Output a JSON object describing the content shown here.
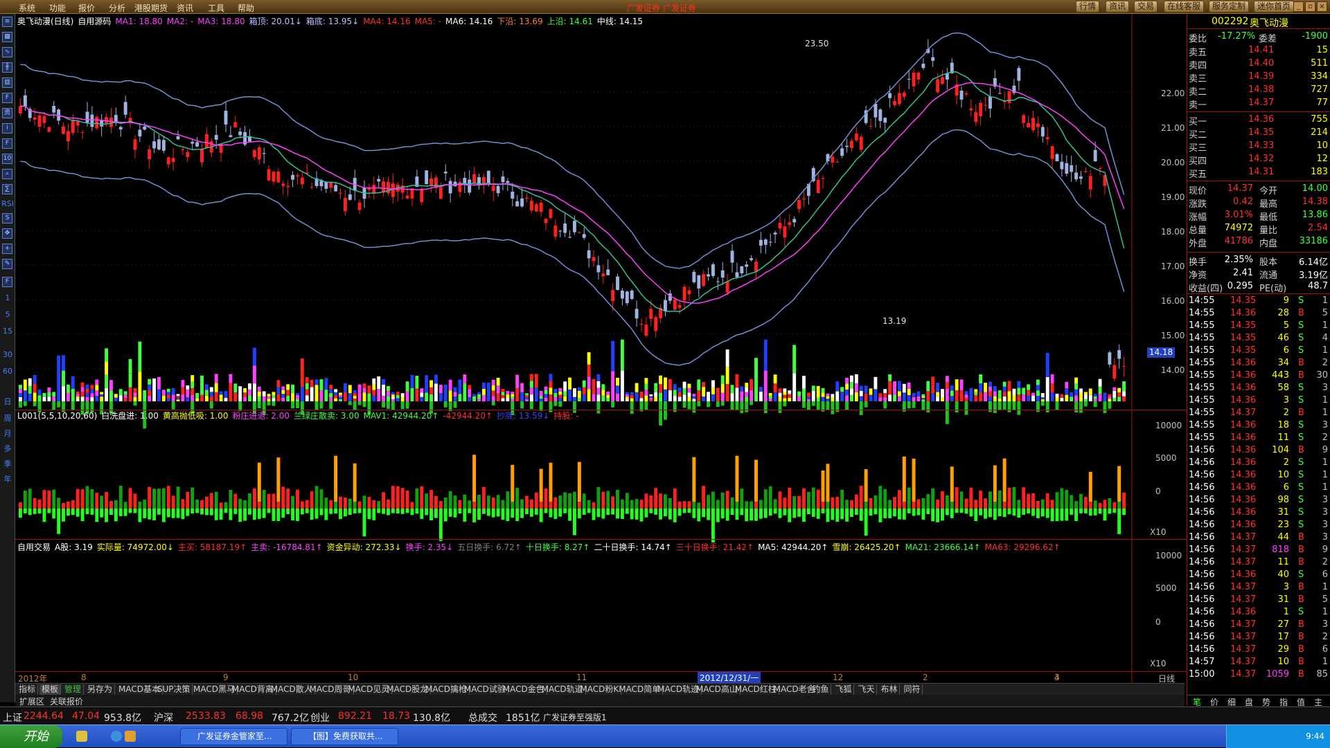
{
  "menu": {
    "items": [
      "系统",
      "功能",
      "报价",
      "分析",
      "港股期货",
      "资讯",
      "工具",
      "帮助"
    ],
    "brand": "广发证券 广发证券",
    "right_buttons": [
      "行情",
      "资讯",
      "交易",
      "在线客服",
      "服务定制",
      "迷你首页"
    ]
  },
  "left_toolbar": {
    "periods": [
      "1",
      "5",
      "15",
      "30",
      "60",
      "日",
      "周",
      "月",
      "多",
      "季",
      "年"
    ]
  },
  "main_panel": {
    "title": "奥飞动漫(日线)",
    "source": "自用源码",
    "indicators": [
      {
        "text": "MA1: 18.80",
        "color": "#ff40ff"
      },
      {
        "text": "MA2: -",
        "color": "#ff40ff"
      },
      {
        "text": "MA3: 18.80",
        "color": "#ff40ff"
      },
      {
        "text": "箱顶: 20.01↓",
        "color": "#c0c0ff"
      },
      {
        "text": "箱底: 13.95↓",
        "color": "#c0c0ff"
      },
      {
        "text": "MA4: 14.16",
        "color": "#ff3030"
      },
      {
        "text": "MA5: -",
        "color": "#ff3030"
      },
      {
        "text": "MA6: 14.16",
        "color": "#ffffff"
      },
      {
        "text": "下沿: 13.69",
        "color": "#ff8040"
      },
      {
        "text": "上沿: 14.61",
        "color": "#40ff40"
      },
      {
        "text": "中线: 14.15",
        "color": "#ffffff"
      }
    ],
    "y_labels": [
      "22.00",
      "21.00",
      "20.00",
      "19.00",
      "18.00",
      "17.00",
      "16.00",
      "15.00",
      "14.00"
    ],
    "high_label": "23.50",
    "low_label": "13.19",
    "current_tag": "14.18"
  },
  "mid_panel": {
    "title": "L001(5,5,10,20,60)",
    "indicators": [
      {
        "text": "白洗盘进: 1.00",
        "color": "#ffffff"
      },
      {
        "text": "黄高抛低吸: 1.00",
        "color": "#ffff00"
      },
      {
        "text": "粉庄进退: 2.00",
        "color": "#ff40ff"
      },
      {
        "text": "兰绿庄散卖: 3.00",
        "color": "#40ff40"
      },
      {
        "text": "MAV1: 42944.20↑",
        "color": "#40ff40"
      },
      {
        "text": "-42944.20↑",
        "color": "#ff3030"
      },
      {
        "text": "抄底: 13.59↓",
        "color": "#4040ff"
      },
      {
        "text": "持股: -",
        "color": "#ff3030"
      }
    ],
    "y_labels": [
      "10000",
      "5000",
      "0"
    ],
    "scale": "X10"
  },
  "low_panel": {
    "title": "自用交易",
    "indicators": [
      {
        "text": "A股: 3.19",
        "color": "#ffffff"
      },
      {
        "text": "实际量: 74972.00↓",
        "color": "#ffff00"
      },
      {
        "text": "主买: 58187.19↑",
        "color": "#ff3030"
      },
      {
        "text": "主卖: -16784.81↑",
        "color": "#ff40ff"
      },
      {
        "text": "资金异动: 272.33↓",
        "color": "#ffff00"
      },
      {
        "text": "换手: 2.35↓",
        "color": "#ff40ff"
      },
      {
        "text": "五日换手: 6.72↑",
        "color": "#808080"
      },
      {
        "text": "十日换手: 8.27↑",
        "color": "#40ff40"
      },
      {
        "text": "二十日换手: 14.74↑",
        "color": "#ffffff"
      },
      {
        "text": "三十日换手: 21.42↑",
        "color": "#ff3030"
      },
      {
        "text": "MA5: 42944.20↑",
        "color": "#ffffff"
      },
      {
        "text": "雪崩: 26425.20↑",
        "color": "#ffff00"
      },
      {
        "text": "MA21: 23666.14↑",
        "color": "#40ff40"
      },
      {
        "text": "MA63: 29296.62↑",
        "color": "#ff3030"
      }
    ],
    "y_labels": [
      "10000",
      "5000",
      "0"
    ],
    "scale": "X10"
  },
  "time_axis": {
    "labels": [
      "2012年",
      "8",
      "9",
      "10",
      "11",
      "12",
      "2",
      "3",
      "4"
    ],
    "highlight": "2012/12/31/一",
    "right_label": "日线"
  },
  "bottom_tabs": [
    "指标",
    "模板",
    "管理",
    "另存为",
    "MACD基本",
    "SUP决策",
    "MACD黑马",
    "MACD背离",
    "MACD散人",
    "MACD周哥",
    "MACD见灵",
    "MACD股龙",
    "MACD擒枪",
    "MACD试验",
    "MACD金色",
    "MACD轨道",
    "MACD粉K",
    "MACD简单",
    "MACD轨迹",
    "MACD高山",
    "MACD红柱",
    "MACD老舍",
    "钓鱼",
    "飞狐",
    "飞天",
    "布林",
    "同符"
  ],
  "ext_tabs": [
    "扩展区",
    "关联报价"
  ],
  "quote": {
    "code": "002292",
    "name": "奥飞动漫",
    "webi": {
      "label": "委比",
      "value": "-17.27%",
      "label2": "委差",
      "value2": "-1900"
    },
    "asks": [
      {
        "label": "卖五",
        "price": "14.41",
        "vol": "15"
      },
      {
        "label": "卖四",
        "price": "14.40",
        "vol": "511"
      },
      {
        "label": "卖三",
        "price": "14.39",
        "vol": "334"
      },
      {
        "label": "卖二",
        "price": "14.38",
        "vol": "727"
      },
      {
        "label": "卖一",
        "price": "14.37",
        "vol": "77"
      }
    ],
    "bids": [
      {
        "label": "买一",
        "price": "14.36",
        "vol": "755"
      },
      {
        "label": "买二",
        "price": "14.35",
        "vol": "214"
      },
      {
        "label": "买三",
        "price": "14.33",
        "vol": "10"
      },
      {
        "label": "买四",
        "price": "14.32",
        "vol": "12"
      },
      {
        "label": "买五",
        "price": "14.31",
        "vol": "183"
      }
    ],
    "stats": [
      {
        "l1": "现价",
        "v1": "14.37",
        "c1": "#ff3030",
        "l2": "今开",
        "v2": "14.00",
        "c2": "#40ff40"
      },
      {
        "l1": "涨跌",
        "v1": "0.42",
        "c1": "#ff3030",
        "l2": "最高",
        "v2": "14.38",
        "c2": "#ff3030"
      },
      {
        "l1": "涨幅",
        "v1": "3.01%",
        "c1": "#ff3030",
        "l2": "最低",
        "v2": "13.86",
        "c2": "#40ff40"
      },
      {
        "l1": "总量",
        "v1": "74972",
        "c1": "#ffff00",
        "l2": "量比",
        "v2": "2.54",
        "c2": "#ff3030"
      },
      {
        "l1": "外盘",
        "v1": "41786",
        "c1": "#ff3030",
        "l2": "内盘",
        "v2": "33186",
        "c2": "#40ff40"
      },
      {
        "l1": "换手",
        "v1": "2.35%",
        "c1": "#ffffff",
        "l2": "股本",
        "v2": "6.14亿",
        "c2": "#ffffff"
      },
      {
        "l1": "净资",
        "v1": "2.41",
        "c1": "#ffffff",
        "l2": "流通",
        "v2": "3.19亿",
        "c2": "#ffffff"
      },
      {
        "l1": "收益(四)",
        "v1": "0.295",
        "c1": "#ffffff",
        "l2": "PE(动)",
        "v2": "48.7",
        "c2": "#ffffff"
      }
    ],
    "ticks": [
      {
        "t": "14:55",
        "p": "14.35",
        "v": "9",
        "d": "S",
        "n": "1"
      },
      {
        "t": "14:55",
        "p": "14.36",
        "v": "28",
        "d": "B",
        "n": "5"
      },
      {
        "t": "14:55",
        "p": "14.35",
        "v": "5",
        "d": "S",
        "n": "1"
      },
      {
        "t": "14:55",
        "p": "14.35",
        "v": "46",
        "d": "S",
        "n": "4"
      },
      {
        "t": "14:55",
        "p": "14.35",
        "v": "6",
        "d": "S",
        "n": "1"
      },
      {
        "t": "14:55",
        "p": "14.36",
        "v": "34",
        "d": "B",
        "n": "2"
      },
      {
        "t": "14:55",
        "p": "14.36",
        "v": "443",
        "d": "B",
        "n": "30"
      },
      {
        "t": "14:55",
        "p": "14.36",
        "v": "58",
        "d": "S",
        "n": "3"
      },
      {
        "t": "14:55",
        "p": "14.36",
        "v": "3",
        "d": "S",
        "n": "1"
      },
      {
        "t": "14:55",
        "p": "14.37",
        "v": "2",
        "d": "B",
        "n": "1"
      },
      {
        "t": "14:55",
        "p": "14.36",
        "v": "18",
        "d": "S",
        "n": "3"
      },
      {
        "t": "14:55",
        "p": "14.36",
        "v": "11",
        "d": "S",
        "n": "2"
      },
      {
        "t": "14:56",
        "p": "14.36",
        "v": "104",
        "d": "B",
        "n": "9"
      },
      {
        "t": "14:56",
        "p": "14.36",
        "v": "2",
        "d": "S",
        "n": "1"
      },
      {
        "t": "14:56",
        "p": "14.36",
        "v": "10",
        "d": "S",
        "n": "1"
      },
      {
        "t": "14:56",
        "p": "14.36",
        "v": "6",
        "d": "S",
        "n": "1"
      },
      {
        "t": "14:56",
        "p": "14.36",
        "v": "98",
        "d": "S",
        "n": "3"
      },
      {
        "t": "14:56",
        "p": "14.36",
        "v": "31",
        "d": "S",
        "n": "3"
      },
      {
        "t": "14:56",
        "p": "14.36",
        "v": "23",
        "d": "S",
        "n": "3"
      },
      {
        "t": "14:56",
        "p": "14.37",
        "v": "44",
        "d": "B",
        "n": "3"
      },
      {
        "t": "14:56",
        "p": "14.37",
        "v": "818",
        "d": "B",
        "n": "9"
      },
      {
        "t": "14:56",
        "p": "14.37",
        "v": "11",
        "d": "B",
        "n": "2"
      },
      {
        "t": "14:56",
        "p": "14.36",
        "v": "40",
        "d": "S",
        "n": "6"
      },
      {
        "t": "14:56",
        "p": "14.37",
        "v": "3",
        "d": "B",
        "n": "1"
      },
      {
        "t": "14:56",
        "p": "14.37",
        "v": "31",
        "d": "B",
        "n": "5"
      },
      {
        "t": "14:56",
        "p": "14.36",
        "v": "1",
        "d": "S",
        "n": "1"
      },
      {
        "t": "14:56",
        "p": "14.37",
        "v": "27",
        "d": "B",
        "n": "3"
      },
      {
        "t": "14:56",
        "p": "14.37",
        "v": "17",
        "d": "B",
        "n": "2"
      },
      {
        "t": "14:56",
        "p": "14.37",
        "v": "29",
        "d": "B",
        "n": "6"
      },
      {
        "t": "14:57",
        "p": "14.37",
        "v": "10",
        "d": "B",
        "n": "1"
      },
      {
        "t": "15:00",
        "p": "14.37",
        "v": "1059",
        "d": "B",
        "n": "85"
      }
    ],
    "panel_tabs": [
      "笔",
      "价",
      "细",
      "盘",
      "势",
      "指",
      "值",
      "主"
    ]
  },
  "statusbar": {
    "items": [
      {
        "text": "上证",
        "color": "#e0e0e0"
      },
      {
        "text": "2244.64",
        "color": "#ff3030"
      },
      {
        "text": "47.04",
        "color": "#ff3030"
      },
      {
        "text": "953.8亿",
        "color": "#e0e0e0"
      },
      {
        "text": "沪深",
        "color": "#e0e0e0"
      },
      {
        "text": "2533.83",
        "color": "#ff3030"
      },
      {
        "text": "68.98",
        "color": "#ff3030"
      },
      {
        "text": "767.2亿",
        "color": "#e0e0e0"
      },
      {
        "text": "创业",
        "color": "#e0e0e0"
      },
      {
        "text": "892.21",
        "color": "#ff3030"
      },
      {
        "text": "18.73",
        "color": "#ff3030"
      },
      {
        "text": "130.8亿",
        "color": "#e0e0e0"
      },
      {
        "text": "总成交",
        "color": "#e0e0e0"
      },
      {
        "text": "1851亿",
        "color": "#e0e0e0"
      },
      {
        "text": "广发证券至强版1",
        "color": "#e0e0e0"
      }
    ]
  },
  "taskbar": {
    "start": "开始",
    "tasks": [
      "广发证券金管家至...",
      "【图】免费获取共..."
    ],
    "clock": "9:44"
  }
}
